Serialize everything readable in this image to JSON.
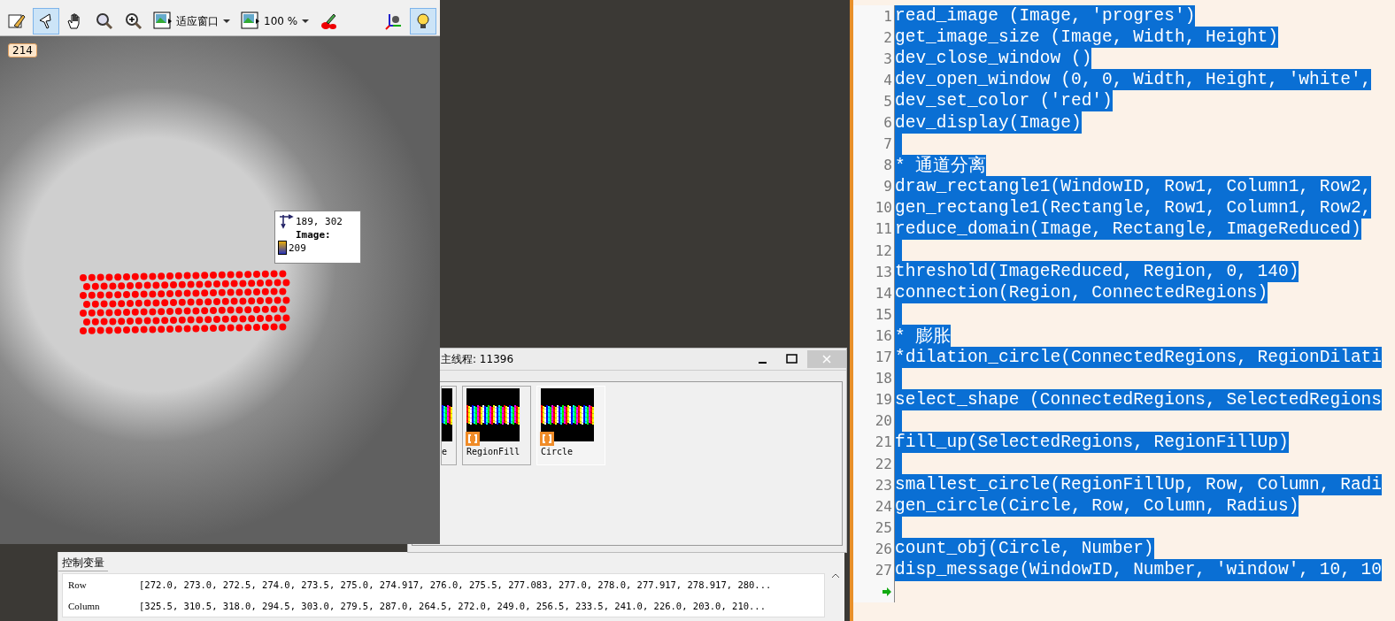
{
  "graphics_window": {
    "toolbar": {
      "tools": [
        {
          "kind": "icon",
          "selected": false
        },
        {
          "kind": "icon",
          "selected": true
        },
        {
          "kind": "icon",
          "selected": false
        },
        {
          "kind": "icon",
          "selected": false
        },
        {
          "kind": "icon",
          "selected": false
        },
        {
          "kind": "dropdown",
          "label": "适应窗口",
          "selected": false
        },
        {
          "kind": "dropdown",
          "label": "100 %",
          "selected": false
        },
        {
          "kind": "icon",
          "selected": false
        },
        {
          "kind": "icon",
          "selected": false
        },
        {
          "kind": "icon",
          "selected": true
        }
      ]
    },
    "badge": "214",
    "tooltip": {
      "coords": "189, 302",
      "label": "Image:",
      "value": "209"
    }
  },
  "variable_window": {
    "title": "主线程: 11396",
    "thumbnails": [
      {
        "label": "e"
      },
      {
        "label": "RegionFill"
      },
      {
        "label": "Circle"
      }
    ]
  },
  "control_variables": {
    "title": "控制变量",
    "rows": [
      {
        "name": "Row",
        "value": "[272.0, 273.0, 272.5, 274.0, 273.5, 275.0, 274.917, 276.0, 275.5, 277.083, 277.0, 278.0, 277.917, 278.917, 280..."
      },
      {
        "name": "Column",
        "value": "[325.5, 310.5, 318.0, 294.5, 303.0, 279.5, 287.0, 264.5, 272.0, 249.0, 256.5, 233.5, 241.0, 226.0, 203.0, 210..."
      }
    ]
  },
  "editor": {
    "lines": [
      {
        "number": "1",
        "code": "read_image (Image, 'progres')",
        "selected": true
      },
      {
        "number": "2",
        "code": "get_image_size (Image, Width, Height)",
        "selected": true
      },
      {
        "number": "3",
        "code": "dev_close_window ()",
        "selected": true
      },
      {
        "number": "4",
        "code": "dev_open_window (0, 0, Width, Height, 'white',",
        "selected": true
      },
      {
        "number": "5",
        "code": "dev_set_color ('red')",
        "selected": true
      },
      {
        "number": "6",
        "code": "dev_display(Image)",
        "selected": true
      },
      {
        "number": "7",
        "selected": true
      },
      {
        "number": "8",
        "code": "* 通道分离",
        "selected": true
      },
      {
        "number": "9",
        "code": "draw_rectangle1(WindowID, Row1, Column1, Row2,",
        "selected": true
      },
      {
        "number": "10",
        "code": "gen_rectangle1(Rectangle, Row1, Column1, Row2,",
        "selected": true
      },
      {
        "number": "11",
        "code": "reduce_domain(Image, Rectangle, ImageReduced)",
        "selected": true
      },
      {
        "number": "12",
        "selected": true
      },
      {
        "number": "13",
        "code": "threshold(ImageReduced, Region, 0, 140)",
        "selected": true
      },
      {
        "number": "14",
        "code": "connection(Region, ConnectedRegions)",
        "selected": true
      },
      {
        "number": "15",
        "selected": true
      },
      {
        "number": "16",
        "code": "* 膨胀",
        "selected": true
      },
      {
        "number": "17",
        "code": "*dilation_circle(ConnectedRegions, RegionDilati",
        "selected": true
      },
      {
        "number": "18",
        "selected": true
      },
      {
        "number": "19",
        "code": "select_shape (ConnectedRegions, SelectedRegions",
        "selected": true
      },
      {
        "number": "20",
        "selected": true
      },
      {
        "number": "21",
        "code": "fill_up(SelectedRegions, RegionFillUp)",
        "selected": true
      },
      {
        "number": "22",
        "selected": true
      },
      {
        "number": "23",
        "code": "smallest_circle(RegionFillUp, Row, Column, Radi",
        "selected": true
      },
      {
        "number": "24",
        "code": "gen_circle(Circle, Row, Column, Radius)",
        "selected": true
      },
      {
        "number": "25",
        "selected": true
      },
      {
        "number": "26",
        "code": "count_obj(Circle, Number)",
        "selected": true
      },
      {
        "number": "27",
        "code": "disp_message(WindowID, Number, 'window', 10, 10",
        "selected": true
      }
    ]
  }
}
